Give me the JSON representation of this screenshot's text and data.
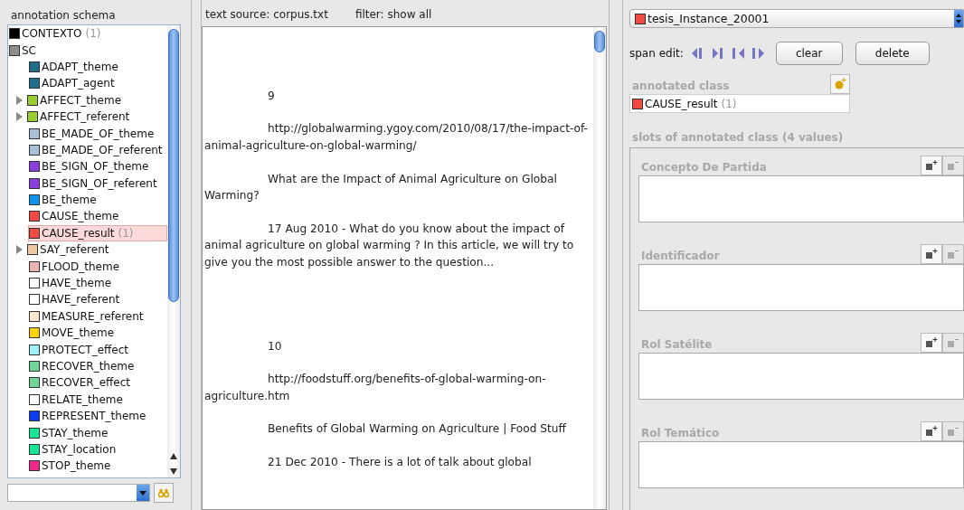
{
  "schema_panel": {
    "title": "annotation schema",
    "tree": [
      {
        "label": "CONTEXTO",
        "color": "#000000",
        "count": "(1)",
        "selected": false
      },
      {
        "label": "SC",
        "color": "#8c8c8c",
        "selected": false,
        "children": [
          {
            "label": "ADAPT_theme",
            "color": "#1f6e8c",
            "selected": false
          },
          {
            "label": "ADAPT_agent",
            "color": "#1f6e8c",
            "selected": false
          },
          {
            "label": "AFFECT_theme",
            "color": "#9acd32",
            "selected": false,
            "expanded": false
          },
          {
            "label": "AFFECT_referent",
            "color": "#9acd32",
            "selected": false,
            "expanded": false
          },
          {
            "label": "BE_MADE_OF_theme",
            "color": "#a9c0d9",
            "selected": false
          },
          {
            "label": "BE_MADE_OF_referent",
            "color": "#a9c0d9",
            "selected": false
          },
          {
            "label": "BE_SIGN_OF_theme",
            "color": "#8a3ee0",
            "selected": false
          },
          {
            "label": "BE_SIGN_OF_referent",
            "color": "#8a3ee0",
            "selected": false
          },
          {
            "label": "BE_theme",
            "color": "#0b95f0",
            "selected": false
          },
          {
            "label": "CAUSE_theme",
            "color": "#f24a43",
            "selected": false
          },
          {
            "label": "CAUSE_result",
            "color": "#f24a43",
            "count": "(1)",
            "selected": true
          },
          {
            "label": "SAY_referent",
            "color": "#f0c8a0",
            "selected": false,
            "expanded": false
          },
          {
            "label": "FLOOD_theme",
            "color": "#eab4b4",
            "selected": false
          },
          {
            "label": "HAVE_theme",
            "color": "#ffffff",
            "selected": false
          },
          {
            "label": "HAVE_referent",
            "color": "#ffffff",
            "selected": false
          },
          {
            "label": "MEASURE_referent",
            "color": "#fbe6cf",
            "selected": false
          },
          {
            "label": "MOVE_theme",
            "color": "#ffd200",
            "selected": false
          },
          {
            "label": "PROTECT_effect",
            "color": "#9ef0f8",
            "selected": false
          },
          {
            "label": "RECOVER_theme",
            "color": "#6fd69a",
            "selected": false
          },
          {
            "label": "RECOVER_effect",
            "color": "#6fd69a",
            "selected": false
          },
          {
            "label": "RELATE_theme",
            "color": "#ffffff",
            "selected": false
          },
          {
            "label": "REPRESENT_theme",
            "color": "#0b3af0",
            "selected": false
          },
          {
            "label": "STAY_theme",
            "color": "#14e896",
            "selected": false
          },
          {
            "label": "STAY_location",
            "color": "#14e896",
            "selected": false
          },
          {
            "label": "STOP_theme",
            "color": "#f0288c",
            "selected": false
          }
        ]
      }
    ]
  },
  "text_panel": {
    "source": "text source: corpus.txt",
    "filter": "filter: show all",
    "paragraphs": [
      {
        "kind": "number",
        "text": "9"
      },
      {
        "kind": "text",
        "text": "http://globalwarming.ygoy.com/2010/08/17/the-impact-of-animal-agriculture-on-global-warming/"
      },
      {
        "kind": "text",
        "text": "What are the Impact of Animal Agriculture on Global Warming?"
      },
      {
        "kind": "text",
        "text": "17 Aug 2010 - What do you know about the impact of animal agriculture on global warming ? In this article, we will try to give you the most possible answer to the question..."
      },
      {
        "kind": "number",
        "text": "10"
      },
      {
        "kind": "text",
        "text": "http://foodstuff.org/benefits-of-global-warming-on-agriculture.htm"
      },
      {
        "kind": "text",
        "text": "Benefits of Global Warming on Agriculture | Food Stuff"
      },
      {
        "kind": "text",
        "text": "21 Dec 2010 - There is a lot of talk about global"
      }
    ]
  },
  "annotation_panel": {
    "instance": {
      "label": "tesis_Instance_20001",
      "color": "#f24a43"
    },
    "span_edit_label": "span edit:",
    "buttons": [
      "clear",
      "delete"
    ],
    "annotated_class": {
      "title": "annotated class",
      "label": "CAUSE_result",
      "count": "(1)",
      "color": "#f24a43"
    },
    "slots_title": "slots of annotated class (4 values)",
    "slots": [
      {
        "label": "Concepto De Partida"
      },
      {
        "label": "Identificador"
      },
      {
        "label": "Rol Satélite"
      },
      {
        "label": "Rol Temático"
      }
    ]
  }
}
